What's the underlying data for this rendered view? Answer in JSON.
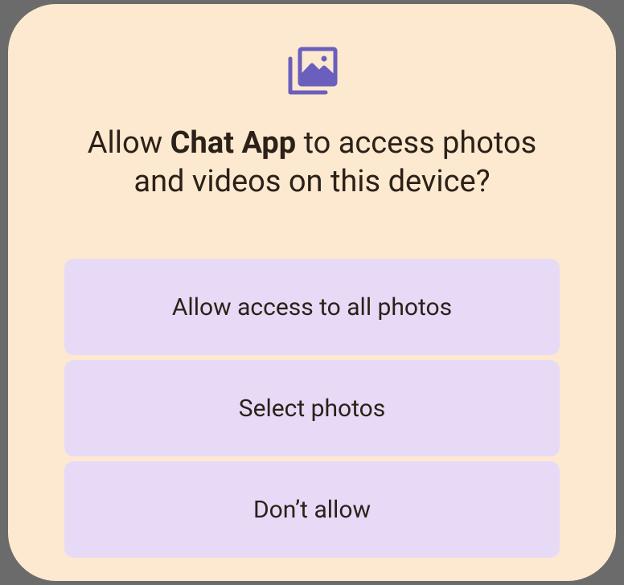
{
  "dialog": {
    "title_prefix": "Allow ",
    "app_name": "Chat App",
    "title_suffix": " to access photos and videos on this device?",
    "buttons": {
      "allow_all": "Allow access to all photos",
      "select": "Select photos",
      "deny": "Don’t allow"
    }
  }
}
